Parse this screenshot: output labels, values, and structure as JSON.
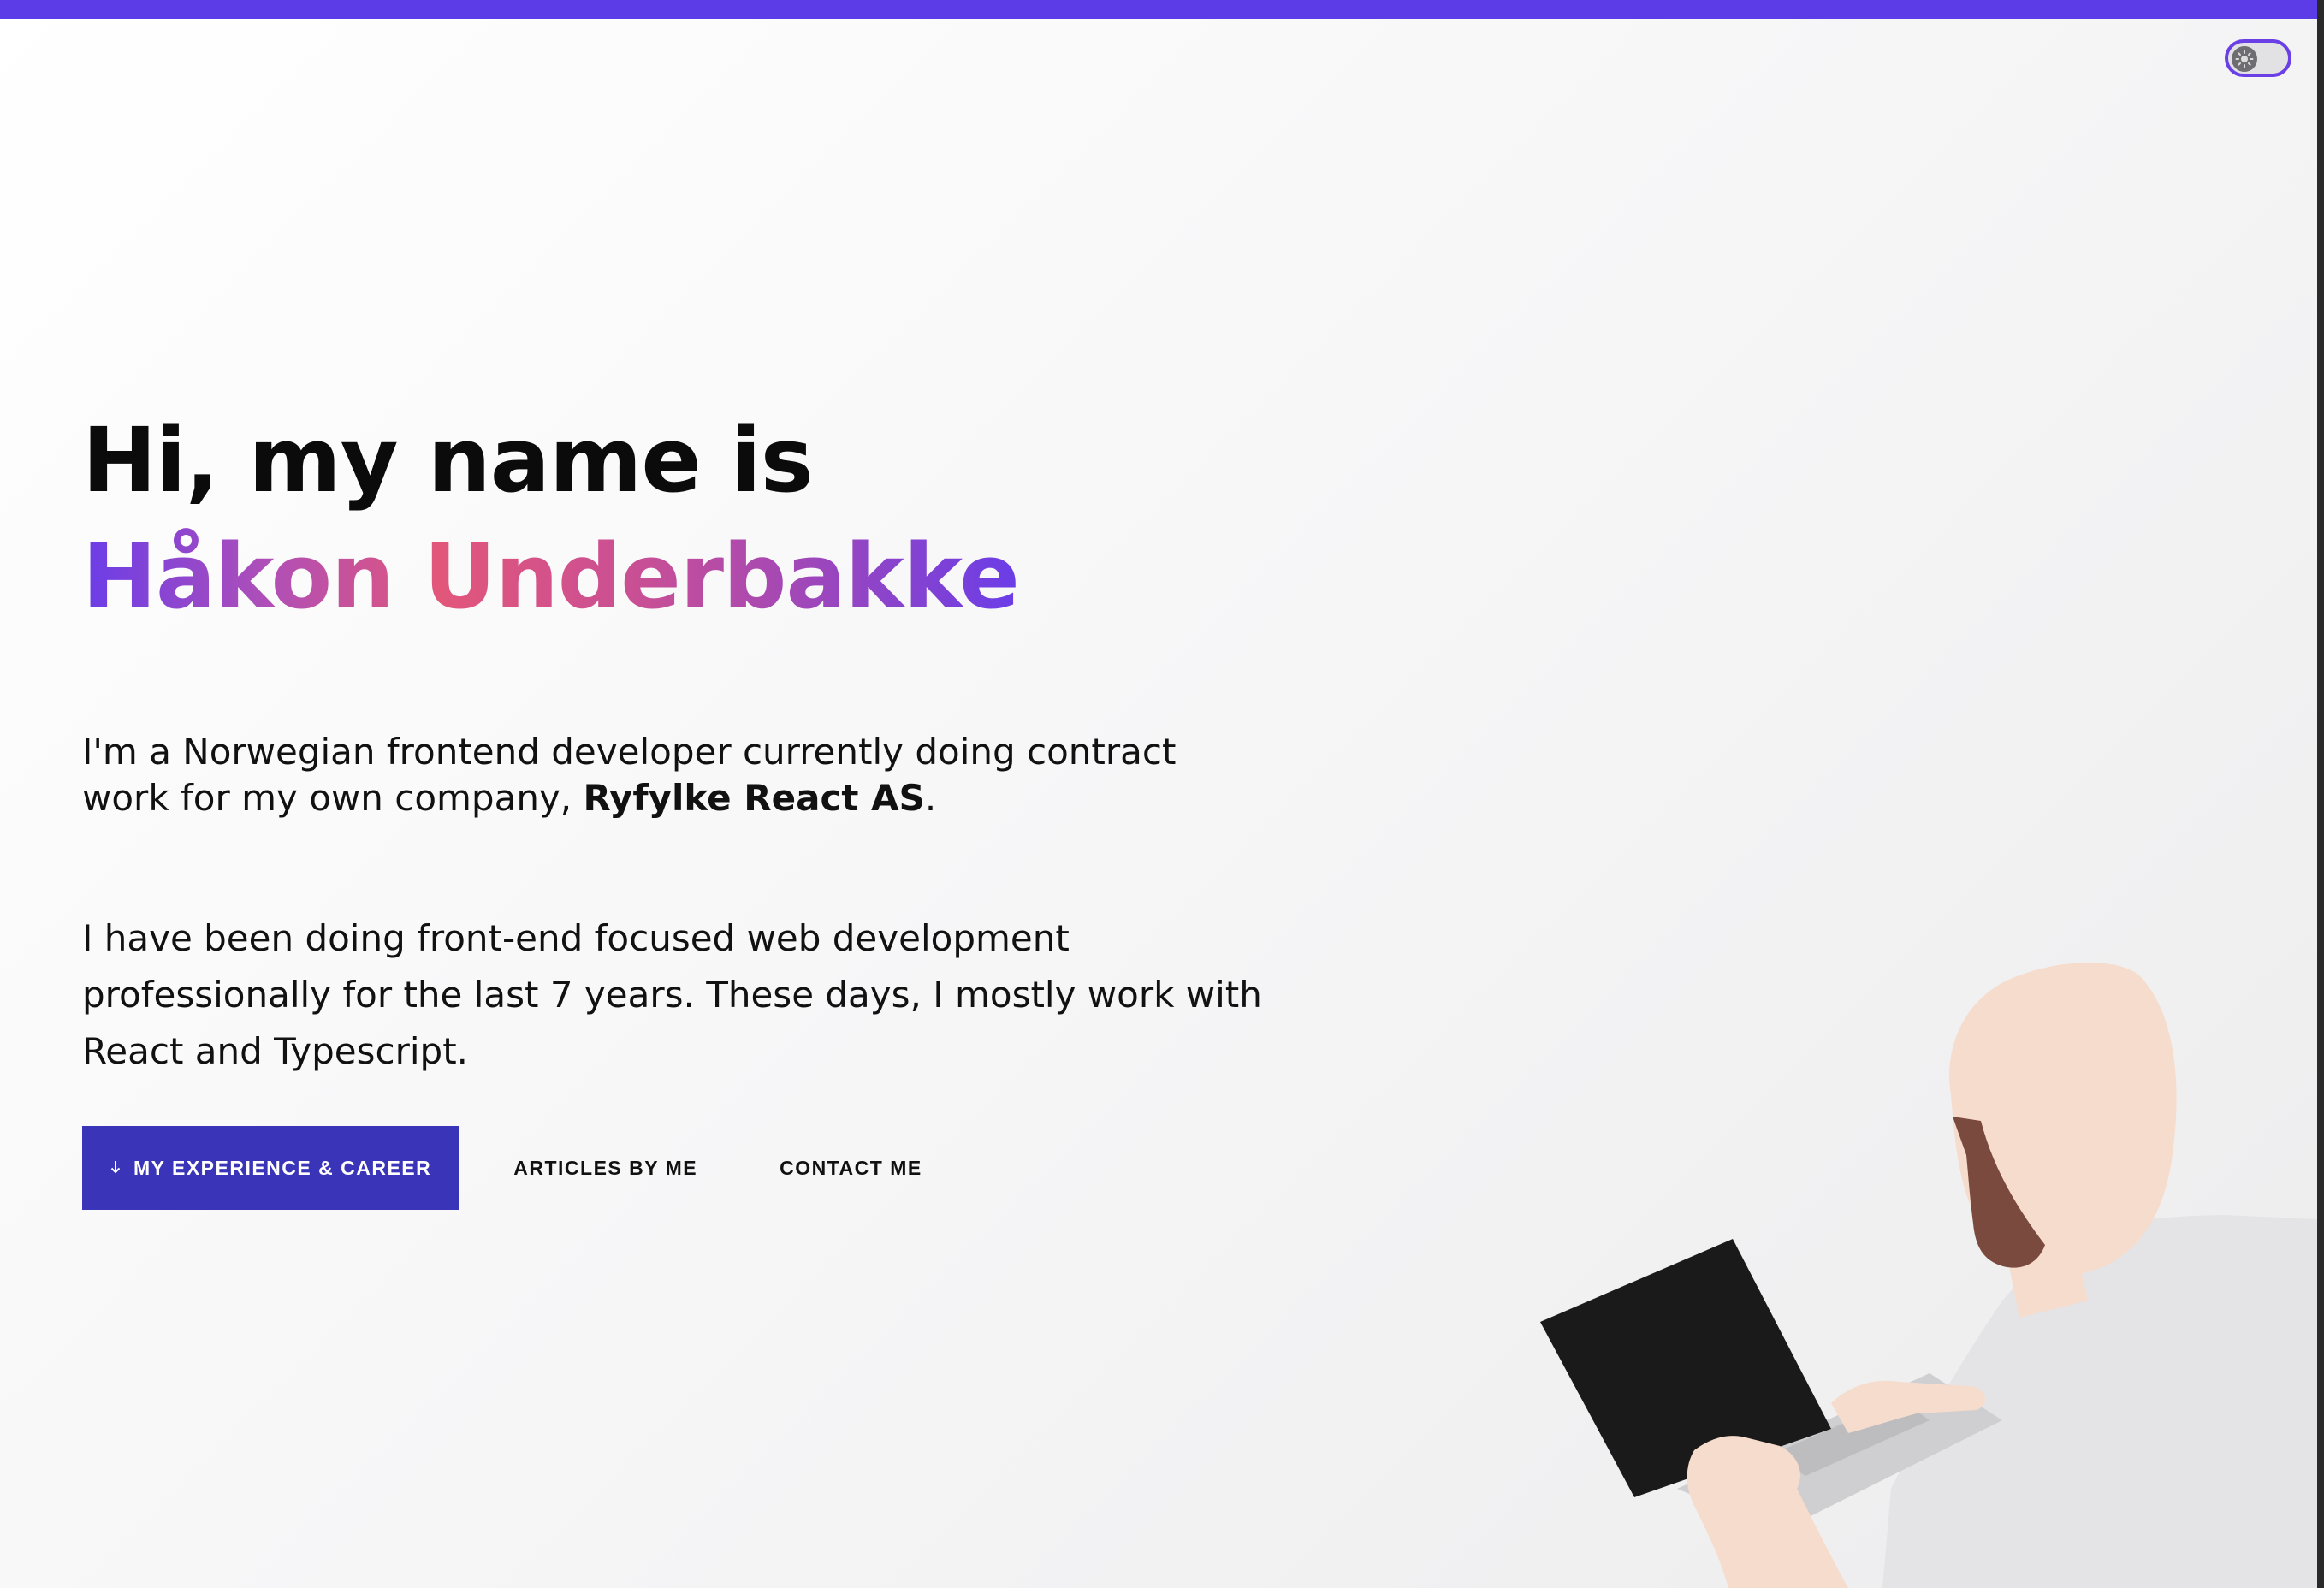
{
  "header": {
    "accent_color": "#5b3ce6",
    "theme_toggle": {
      "icon": "sun-icon",
      "state": "light"
    }
  },
  "hero": {
    "greeting": "Hi, my name is",
    "name": "Håkon Underbakke",
    "name_gradient": [
      "#6a3de8",
      "#e2567a",
      "#6a3de8"
    ],
    "intro_prefix": "I'm a Norwegian frontend developer currently doing contract work for my own company, ",
    "intro_company": "Ryfylke React AS",
    "intro_suffix": ".",
    "bio": "I have been doing front-end focused web development professionally for the last 7 years. These days, I mostly work with React and Typescript."
  },
  "actions": {
    "primary_icon": "arrow-down-icon",
    "primary_label": "MY EXPERIENCE & CAREER",
    "primary_color": "#3a35b8",
    "articles_label": "ARTICLES BY ME",
    "contact_label": "CONTACT ME"
  },
  "illustration": {
    "subject": "person-with-laptop",
    "colors": {
      "skin": "#f6dccc",
      "beard": "#7b4a3e",
      "laptop": "#1a1a1a",
      "shirt": "#e4e4e6",
      "keyboard": "#cfcfd2"
    }
  }
}
